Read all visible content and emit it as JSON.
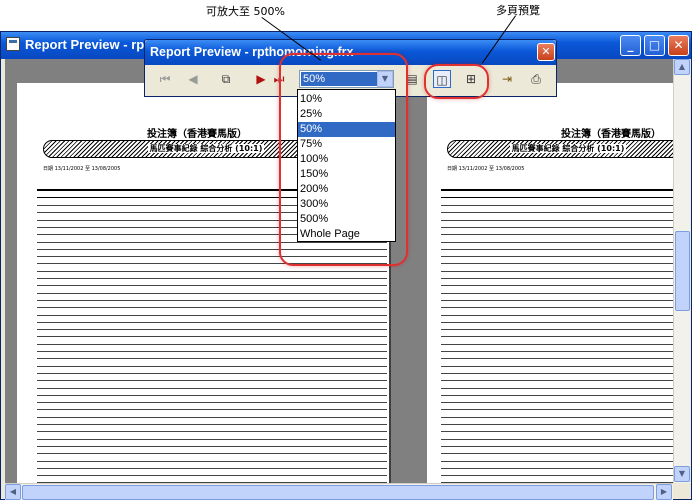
{
  "annotations": {
    "zoom_callout": "可放大至 500%",
    "multipage_callout": "多頁預覽"
  },
  "main_window": {
    "title": "Report Preview - rp",
    "buttons": {
      "minimize": "_",
      "maximize": "□",
      "close": "✕"
    }
  },
  "toolbar_window": {
    "title": "Report Preview - rpthomorning.frx",
    "close": "✕",
    "tools": [
      {
        "name": "first-page-icon",
        "glyph": "⏮"
      },
      {
        "name": "previous-page-icon",
        "glyph": "◀"
      },
      {
        "name": "goto-page-icon",
        "glyph": "⧉"
      },
      {
        "name": "next-page-icon",
        "glyph": "▶"
      },
      {
        "name": "last-page-icon",
        "glyph": "⏭"
      },
      {
        "name": "single-page-icon",
        "glyph": "▤"
      },
      {
        "name": "two-pages-icon",
        "glyph": "◫"
      },
      {
        "name": "four-pages-icon",
        "glyph": "⊞"
      },
      {
        "name": "exit-icon",
        "glyph": "⇥"
      },
      {
        "name": "print-icon",
        "glyph": "⎙"
      }
    ],
    "zoom": {
      "value": "50%",
      "arrow": "▼"
    }
  },
  "zoom_options": [
    "10%",
    "25%",
    "50%",
    "75%",
    "100%",
    "150%",
    "200%",
    "300%",
    "500%",
    "Whole Page"
  ],
  "zoom_selected_index": 2,
  "report_page": {
    "heading": "投注簿（香港賽馬版）",
    "banner": "馬匹賽事紀錄 綜合分析 (10:1)",
    "date_range": "日期 13/11/2002  至 13/08/2005"
  },
  "colors": {
    "accent_blue": "#316ac5",
    "annotation_red": "#e03030"
  }
}
